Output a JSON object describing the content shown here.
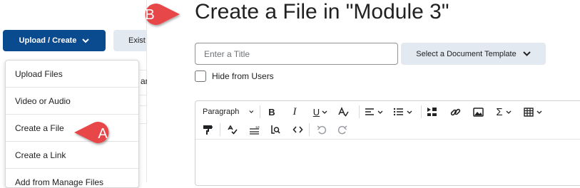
{
  "left_panel": {
    "upload_create_label": "Upload / Create",
    "existing_label": "Exist",
    "background_fragment": "an",
    "menu_items": [
      "Upload Files",
      "Video or Audio",
      "Create a File",
      "Create a Link",
      "Add from Manage Files"
    ]
  },
  "callouts": {
    "a": "A",
    "b": "B",
    "color": "#e8474a"
  },
  "page": {
    "title": "Create a File in \"Module 3\"",
    "title_placeholder": "Enter a Title",
    "template_label": "Select a Document Template",
    "hide_label": "Hide from Users"
  },
  "editor": {
    "paragraph_label": "Paragraph",
    "bold": "B",
    "italic": "I",
    "underline": "U",
    "sigma": "Σ"
  },
  "colors": {
    "primary": "#0a4a8f",
    "secondary_button": "#e3e9f1"
  }
}
